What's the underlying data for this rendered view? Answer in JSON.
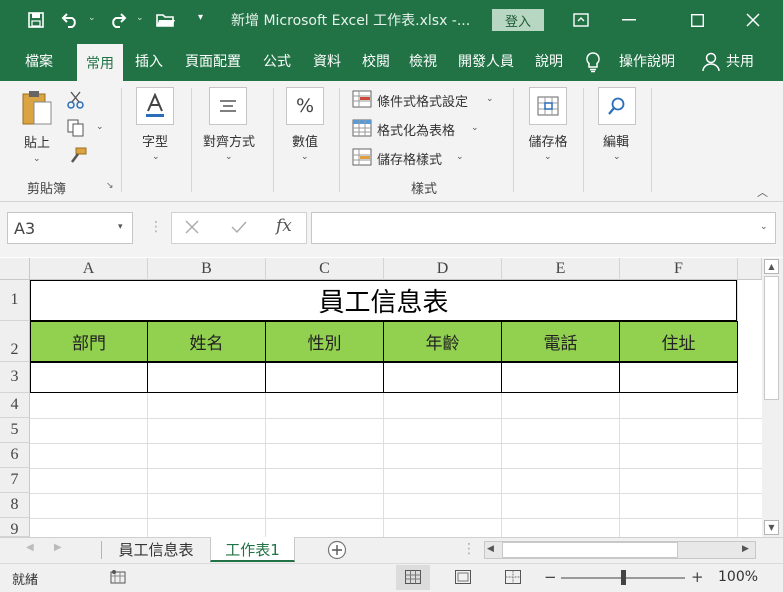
{
  "titlebar": {
    "title": "新增 Microsoft Excel 工作表.xlsx  -...",
    "login": "登入"
  },
  "tabs": [
    "檔案",
    "常用",
    "插入",
    "頁面配置",
    "公式",
    "資料",
    "校閱",
    "檢視",
    "開發人員",
    "說明",
    "操作說明",
    "共用"
  ],
  "ribbon": {
    "paste": "貼上",
    "clipboard_group": "剪貼簿",
    "font": "字型",
    "alignment": "對齊方式",
    "number": "數值",
    "number_symbol": "%",
    "conditional": "條件式格式設定",
    "format_table": "格式化為表格",
    "cell_styles": "儲存格樣式",
    "styles_group": "樣式",
    "cells": "儲存格",
    "editing": "編輯"
  },
  "formula_bar": {
    "name_box": "A3",
    "fx": "fx"
  },
  "grid": {
    "columns": [
      "A",
      "B",
      "C",
      "D",
      "E",
      "F"
    ],
    "rows": [
      "1",
      "2",
      "3",
      "4",
      "5",
      "6",
      "7",
      "8",
      "9"
    ],
    "title": "員工信息表",
    "headers": [
      "部門",
      "姓名",
      "性別",
      "年齡",
      "電話",
      "住址"
    ]
  },
  "sheets": {
    "tab1": "員工信息表",
    "tab2": "工作表1"
  },
  "status": {
    "ready": "就緒",
    "zoom": "100%",
    "minus": "−",
    "plus": "+"
  },
  "colors": {
    "excel_green": "#217346",
    "header_fill": "#92d050"
  }
}
